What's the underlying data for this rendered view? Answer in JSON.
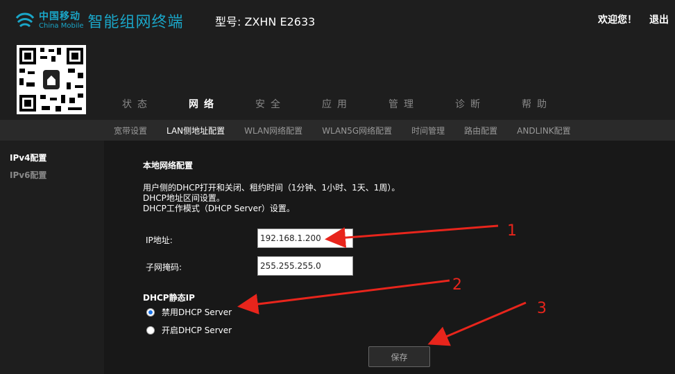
{
  "header": {
    "brand_cn": "中国移动",
    "brand_en": "China Mobile",
    "product": "智能组网终端",
    "model": "型号: ZXHN E2633",
    "welcome": "欢迎您！",
    "logout": "退出"
  },
  "main_nav": [
    {
      "label": "状态"
    },
    {
      "label": "网络"
    },
    {
      "label": "安全"
    },
    {
      "label": "应用"
    },
    {
      "label": "管理"
    },
    {
      "label": "诊断"
    },
    {
      "label": "帮助"
    }
  ],
  "sub_nav": [
    {
      "label": "宽带设置"
    },
    {
      "label": "LAN侧地址配置"
    },
    {
      "label": "WLAN网络配置"
    },
    {
      "label": "WLAN5G网络配置"
    },
    {
      "label": "时间管理"
    },
    {
      "label": "路由配置"
    },
    {
      "label": "ANDLINK配置"
    }
  ],
  "sidebar": [
    {
      "label": "IPv4配置"
    },
    {
      "label": "IPv6配置"
    }
  ],
  "content": {
    "section_title": "本地网络配置",
    "desc_lines": [
      "用户侧的DHCP打开和关闭、租约时间（1分钟、1小时、1天、1周）。",
      "DHCP地址区间设置。",
      "DHCP工作模式（DHCP Server）设置。"
    ],
    "ip_label": "IP地址:",
    "ip_value": "192.168.1.200",
    "mask_label": "子网掩码:",
    "mask_value": "255.255.255.0",
    "dhcp_title": "DHCP静态IP",
    "radio_disable": "禁用DHCP Server",
    "radio_enable": "开启DHCP Server",
    "save": "保存"
  },
  "annotations": {
    "label_1": "1",
    "label_2": "2",
    "label_3": "3",
    "arrow_color": "#e8251c"
  },
  "colors": {
    "brand": "#1aa6c8",
    "background": "#1e1e1e",
    "content_bg": "#181818",
    "subnav_bg": "#2a2a2a"
  }
}
